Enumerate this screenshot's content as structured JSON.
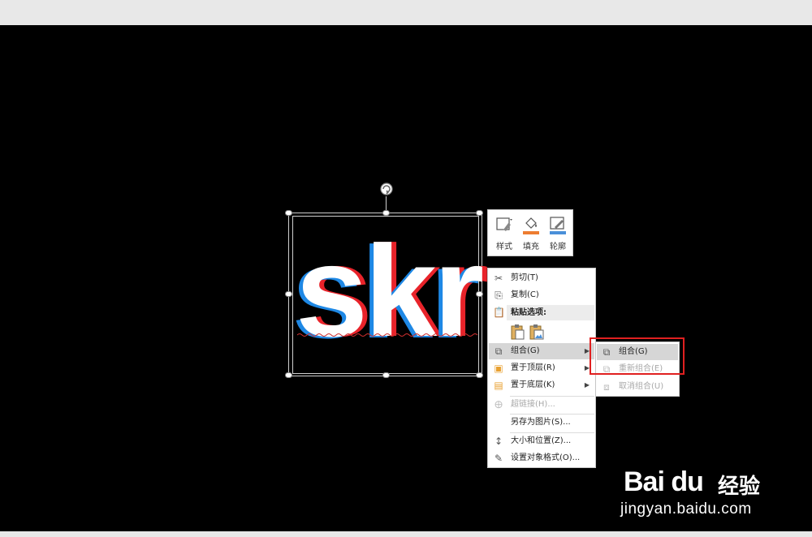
{
  "slide": {
    "text": "skr",
    "colors": {
      "background": "#000000",
      "text": "#ffffff",
      "shadow_red": "#e8232a",
      "shadow_blue": "#1e88e5"
    }
  },
  "mini_toolbar": {
    "buttons": [
      {
        "label": "样式",
        "icon": "shape-style-icon"
      },
      {
        "label": "填充",
        "icon": "fill-bucket-icon",
        "color": "#ed7d31"
      },
      {
        "label": "轮廓",
        "icon": "outline-pen-icon",
        "color": "#4a90d9"
      }
    ]
  },
  "context_menu": {
    "items": [
      {
        "label": "剪切(T)",
        "icon": "scissors-icon"
      },
      {
        "label": "复制(C)",
        "icon": "copy-icon"
      },
      {
        "label": "粘贴选项:",
        "icon": "paste-icon"
      },
      {
        "label": "组合(G)",
        "icon": "group-icon",
        "highlighted": true
      },
      {
        "label": "置于顶层(R)",
        "icon": "bring-to-front-icon"
      },
      {
        "label": "置于底层(K)",
        "icon": "send-to-back-icon"
      },
      {
        "label": "超链接(H)...",
        "icon": "hyperlink-icon",
        "disabled": true
      },
      {
        "label": "另存为图片(S)..."
      },
      {
        "label": "大小和位置(Z)...",
        "icon": "size-position-icon"
      },
      {
        "label": "设置对象格式(O)...",
        "icon": "format-object-icon"
      }
    ]
  },
  "group_submenu": {
    "items": [
      {
        "label": "组合(G)",
        "icon": "group-icon",
        "highlighted": true
      },
      {
        "label": "重新组合(E)",
        "icon": "regroup-icon",
        "disabled": true
      },
      {
        "label": "取消组合(U)",
        "icon": "ungroup-icon",
        "disabled": true
      }
    ]
  },
  "watermark": {
    "brand": "Bai du",
    "cn": "经验",
    "url": "jingyan.baidu.com"
  }
}
